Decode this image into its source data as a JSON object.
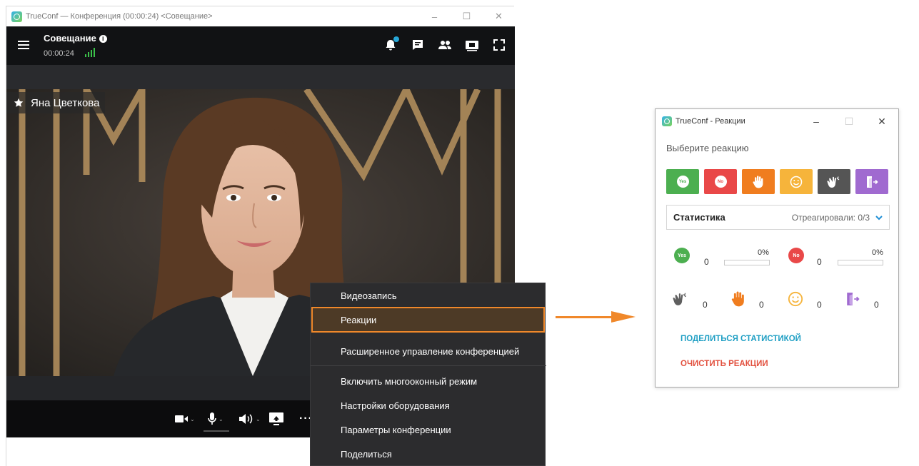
{
  "main_window": {
    "title": "TrueConf — Конференция (00:00:24) <Совещание>",
    "conference_name": "Совещание",
    "info_glyph": "i",
    "conference_time": "00:00:24",
    "participant_name": "Яна Цветкова",
    "header_icons": [
      "bell-icon",
      "chat-icon",
      "participants-icon",
      "layout-icon",
      "fullscreen-icon"
    ],
    "control_icons": [
      "camera-icon",
      "microphone-icon",
      "speaker-icon",
      "screen-share-icon",
      "more-icon"
    ],
    "more_label": "···"
  },
  "menu": {
    "items": [
      "Видеозапись",
      "Реакции",
      "Расширенное управление конференцией",
      "Включить многооконный режим",
      "Настройки оборудования",
      "Параметры конференции",
      "Поделиться"
    ],
    "highlighted_index": 1,
    "highlight_color": "#f0882a"
  },
  "reactions_window": {
    "title": "TrueConf - Реакции",
    "prompt": "Выберите реакцию",
    "buttons": [
      {
        "name": "yes",
        "label": "Yes",
        "color": "#4caf50"
      },
      {
        "name": "no",
        "label": "No",
        "color": "#e94848"
      },
      {
        "name": "raise-hand",
        "color": "#f07d1f"
      },
      {
        "name": "smile",
        "color": "#f6b43b"
      },
      {
        "name": "applause",
        "color": "#555555"
      },
      {
        "name": "leave",
        "color": "#a06ad0"
      }
    ],
    "statistics": {
      "title": "Статистика",
      "reacted": "Отреагировали: 0/3",
      "yes": {
        "label": "Yes",
        "count": "0",
        "percent": "0%"
      },
      "no": {
        "label": "No",
        "count": "0",
        "percent": "0%"
      },
      "applause": {
        "count": "0"
      },
      "raise_hand": {
        "count": "0"
      },
      "smile": {
        "count": "0"
      },
      "leave": {
        "count": "0"
      }
    },
    "share_link": "ПОДЕЛИТЬСЯ СТАТИСТИКОЙ",
    "clear_link": "ОЧИСТИТЬ РЕАКЦИИ",
    "share_color": "#1f9fc4",
    "clear_color": "#e2513f"
  }
}
